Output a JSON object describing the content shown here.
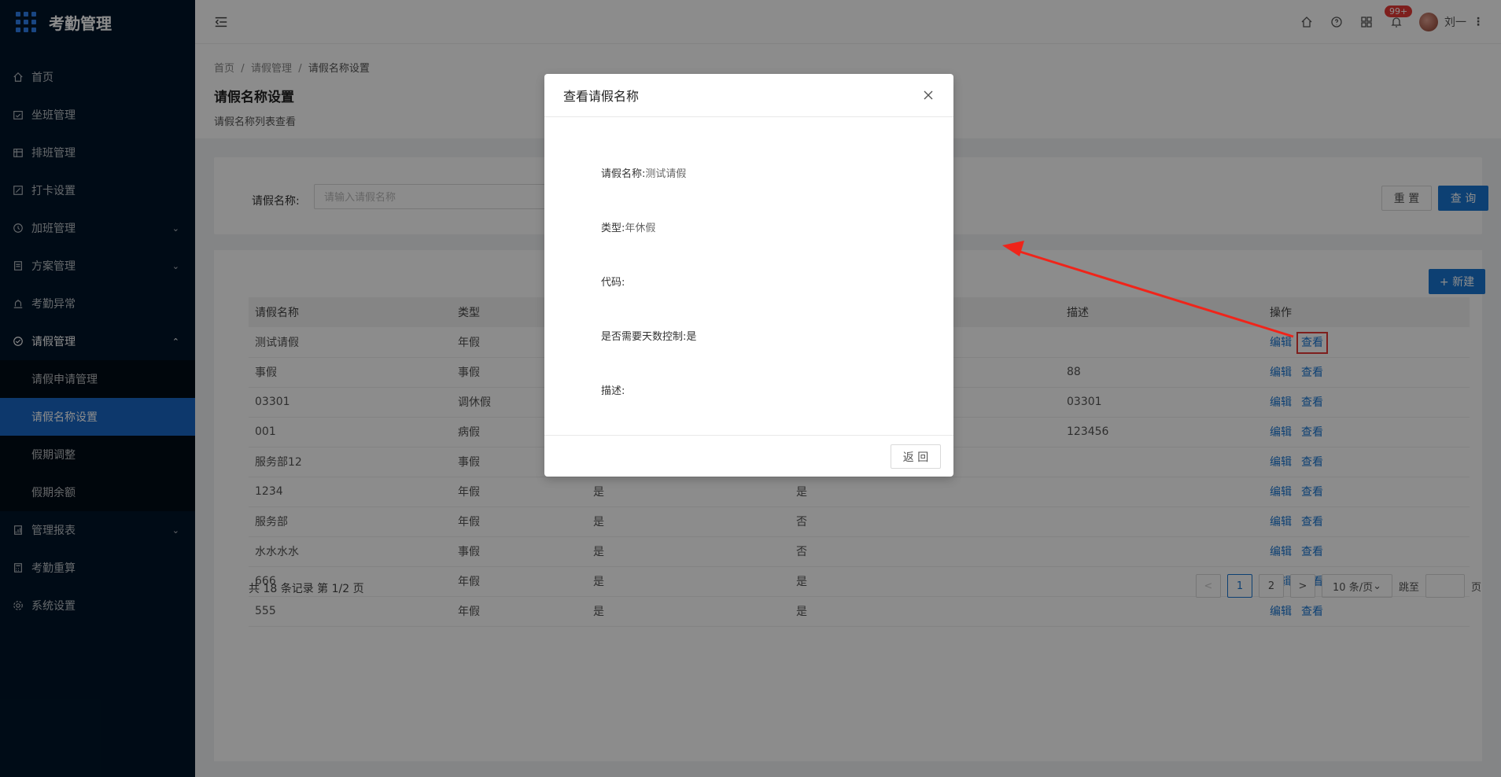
{
  "app": {
    "title": "考勤管理"
  },
  "sidebar": {
    "items": [
      {
        "label": "首页",
        "icon": "home-icon"
      },
      {
        "label": "坐班管理",
        "icon": "calendar-check-icon"
      },
      {
        "label": "排班管理",
        "icon": "schedule-icon"
      },
      {
        "label": "打卡设置",
        "icon": "edit-icon"
      },
      {
        "label": "加班管理",
        "icon": "clock-icon",
        "has_children": true
      },
      {
        "label": "方案管理",
        "icon": "document-icon",
        "has_children": true
      },
      {
        "label": "考勤异常",
        "icon": "alarm-icon"
      },
      {
        "label": "请假管理",
        "icon": "leave-icon",
        "has_children": true,
        "open": true
      },
      {
        "label": "管理报表",
        "icon": "report-icon",
        "has_children": true
      },
      {
        "label": "考勤重算",
        "icon": "calculator-icon"
      },
      {
        "label": "系统设置",
        "icon": "gear-icon"
      }
    ],
    "leave_submenu": [
      "请假申请管理",
      "请假名称设置",
      "假期调整",
      "假期余额"
    ],
    "active_sub": "请假名称设置"
  },
  "header": {
    "notification_count": "99+",
    "user_name": "刘一"
  },
  "breadcrumb": [
    "首页",
    "请假管理",
    "请假名称设置"
  ],
  "page": {
    "title": "请假名称设置",
    "description": "请假名称列表查看"
  },
  "filter": {
    "label": "请假名称:",
    "placeholder": "请输入请假名称",
    "reset_label": "重 置",
    "query_label": "查 询"
  },
  "toolbar": {
    "new_label": "+ 新建"
  },
  "table": {
    "columns": [
      "请假名称",
      "类型",
      "",
      "",
      "描述",
      "操作"
    ],
    "rows": [
      [
        "测试请假",
        "年假",
        "",
        "",
        "",
        ""
      ],
      [
        "事假",
        "事假",
        "",
        "",
        "88",
        ""
      ],
      [
        "03301",
        "调休假",
        "",
        "",
        "03301",
        ""
      ],
      [
        "001",
        "病假",
        "",
        "",
        "123456",
        ""
      ],
      [
        "服务部12",
        "事假",
        "",
        "",
        "",
        ""
      ],
      [
        "1234",
        "年假",
        "是",
        "是",
        "",
        ""
      ],
      [
        "服务部",
        "年假",
        "是",
        "否",
        "",
        ""
      ],
      [
        "水水水水",
        "事假",
        "是",
        "否",
        "",
        ""
      ],
      [
        "666",
        "年假",
        "是",
        "是",
        "",
        ""
      ],
      [
        "555",
        "年假",
        "是",
        "是",
        "",
        ""
      ]
    ],
    "edit_label": "编辑",
    "view_label": "查看"
  },
  "pagination": {
    "total_text": "共 18 条记录 第 1/2 页",
    "pages": [
      "1",
      "2"
    ],
    "current": "1",
    "page_size": "10 条/页",
    "jump_label": "跳至",
    "page_suffix": "页",
    "prev": "<",
    "next": ">"
  },
  "modal": {
    "title": "查看请假名称",
    "fields": [
      {
        "label": "请假名称:",
        "value": "测试请假"
      },
      {
        "label": "类型:",
        "value": "年休假"
      },
      {
        "label": "代码:",
        "value": ""
      },
      {
        "label": "是否需要天数控制:",
        "value": "是"
      },
      {
        "label": "描述:",
        "value": ""
      }
    ],
    "back_label": "返 回"
  },
  "colors": {
    "sidebar_bg": "#001529",
    "primary": "#1976d2",
    "highlight": "#e53935"
  }
}
